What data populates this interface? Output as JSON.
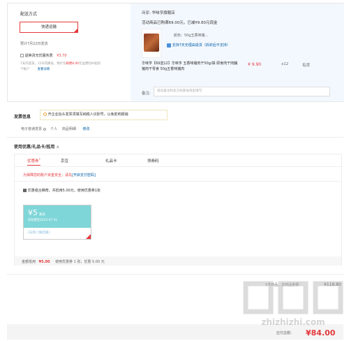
{
  "shipping": {
    "title": "配送方式",
    "express_label": "快递运输",
    "delivery_date": "预计7月22日发货",
    "refund_option": "退换货无忧服务费",
    "refund_price": "¥3.70",
    "refund_desc_a": "7天内退货，15天内换货，预计包",
    "refund_desc_highlight": "邮费8.00",
    "refund_desc_b": "元运费险补贴到",
    "refund_desc_c": "个账户",
    "refund_detail_link": "查看详情"
  },
  "store": {
    "shop_label": "商家:",
    "shop_name": "华味亨旗舰店",
    "promo_text_a": "活动商品已购满69.00元，已减¥9.80元现金",
    "variant": "颜色：50g五香味猪...",
    "support_link": "支持7天无理由退货（拆封后不支持）",
    "product_name": "华味亨【69选12】华味亨 五香味猪肉干50g/袋 即食肉干肉脯 猪肉干零食 50g五香味猪肉",
    "price": "¥ 9.90",
    "qty": "x12",
    "stock": "有货",
    "remark_label": "备注:",
    "remark_placeholder": "提议备注和卖方商家协商后填写"
  },
  "invoice": {
    "title": "发票信息",
    "tip": "开企业抬头发票须填写纳税人识别号，以免影响报销",
    "type": "电子普通发票",
    "payer": "个人",
    "content": "商品明细",
    "edit": "修改"
  },
  "coupon": {
    "title": "使用优惠/礼品卡/抵用",
    "tabs": [
      "优惠券",
      "京豆",
      "礼品卡",
      "领券码"
    ],
    "warning": "为保障您的账户资金安全，请先",
    "warning_link": "[开启支付密码]",
    "combine_text": "优惠组合推荐，共抵用5.00元，使用优惠券1张",
    "card_amount": "¥5",
    "card_type": "满减",
    "card_date": "有效期至2023-07-31",
    "card_tag1": "[东券]",
    "card_tag2": "[限店铺]",
    "summary_label": "金额抵用",
    "summary_amount": "¥5.00",
    "summary_text": "使用优惠券 1 张，优惠 5.00 元"
  },
  "totals": {
    "goods_label": "1件商品，总商品金额：",
    "goods_value": "¥118.80",
    "pay_label": "应付总额：",
    "pay_value": "¥84.00"
  },
  "watermark": "zhizhizhi.com",
  "colors": {
    "accent": "#e4393c",
    "link": "#005ea7",
    "panel": "#f3f8fe",
    "coupon_card": "#7fd6d8"
  }
}
